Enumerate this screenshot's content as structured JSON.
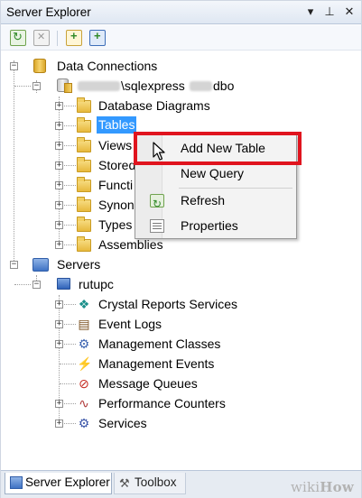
{
  "window": {
    "title": "Server Explorer",
    "controls": {
      "dropdown": "▾",
      "pin": "⊥",
      "close": "✕"
    }
  },
  "toolbar": {
    "icons": [
      "refresh-icon",
      "stop-icon",
      "connect-to-database-icon",
      "connect-to-server-icon"
    ]
  },
  "tree": {
    "data_connections": {
      "label": "Data Connections",
      "connection": {
        "label_mid": "\\sqlexpress",
        "label_end": "dbo"
      },
      "children": [
        "Database Diagrams",
        "Tables",
        "Views",
        "Stored",
        "Functi",
        "Synon",
        "Types",
        "Assemblies"
      ]
    },
    "servers": {
      "label": "Servers",
      "machine": {
        "label": "rutupc",
        "children": [
          "Crystal Reports Services",
          "Event Logs",
          "Management Classes",
          "Management Events",
          "Message Queues",
          "Performance Counters",
          "Services"
        ]
      }
    }
  },
  "context_menu": {
    "items": [
      {
        "label": "Add New Table",
        "icon": ""
      },
      {
        "label": "New Query",
        "icon": ""
      },
      {
        "label": "Refresh",
        "icon": "refresh-icon"
      },
      {
        "label": "Properties",
        "icon": "properties-icon"
      }
    ],
    "highlight_color": "#e0141e"
  },
  "bottom_tabs": [
    {
      "label": "Server Explorer"
    },
    {
      "label": "Toolbox"
    }
  ],
  "watermark": {
    "text_light": "wiki",
    "text_bold": "How"
  }
}
